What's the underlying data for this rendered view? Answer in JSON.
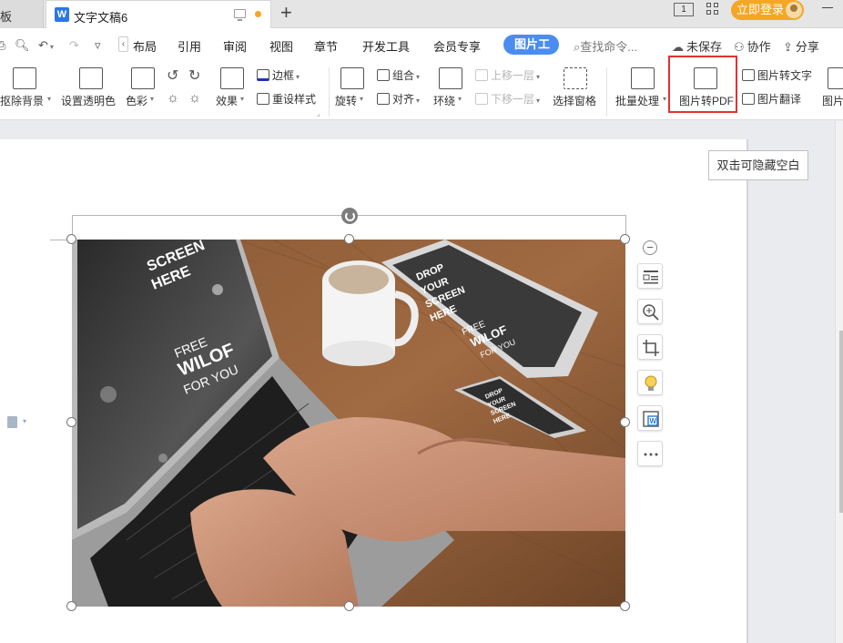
{
  "tabbar": {
    "prev_tab_label": "板",
    "doc_icon_letter": "W",
    "active_tab_title": "文字文稿6",
    "new_tab_symbol": "+",
    "page_indicator": "1",
    "login_label": "立即登录"
  },
  "menu": {
    "items": [
      "布局",
      "引用",
      "审阅",
      "视图",
      "章节",
      "开发工具",
      "会员专享"
    ],
    "active_tab": "图片工具",
    "search_placeholder": "查找命令...",
    "unsaved": "未保存",
    "collaborate": "协作",
    "share": "分享"
  },
  "ribbon": {
    "remove_bg": "抠除背景",
    "set_transparent": "设置透明色",
    "color": "色彩",
    "effects": "效果",
    "border": "边框",
    "reset_style": "重设样式",
    "rotate": "旋转",
    "group": "组合",
    "align": "对齐",
    "wrap": "环绕",
    "bring_forward": "上移一层",
    "send_backward": "下移一层",
    "selection_pane": "选择窗格",
    "batch_process": "批量处理",
    "to_pdf": "图片转PDF",
    "to_text": "图片转文字",
    "translate": "图片翻译",
    "more_cut": "图片"
  },
  "document": {
    "hide_blank_button": "双击可隐藏空白"
  },
  "picture_text": {
    "laptop_top": "SCREEN",
    "laptop_top2": "HERE",
    "laptop_free": "FREE",
    "laptop_wilof": "WILOF",
    "laptop_foryou": "FOR YOU",
    "tablet_drop": "DROP",
    "tablet_your": "YOUR",
    "tablet_screen": "SCREEN",
    "tablet_here": "HERE",
    "tablet_free": "FREE",
    "tablet_wilof": "WILOF",
    "tablet_foryou": "FOR YOU",
    "phone_drop": "DROP",
    "phone_your": "YOUR",
    "phone_screen": "SCREEN",
    "phone_here": "HERE"
  },
  "side_tools": [
    "layout-options-icon",
    "zoom-in-icon",
    "crop-icon",
    "idea-bulb-icon",
    "image-to-doc-icon",
    "more-icon"
  ],
  "colors": {
    "accent": "#4b8cf0",
    "login": "#f5a623",
    "highlight": "#e03232"
  }
}
